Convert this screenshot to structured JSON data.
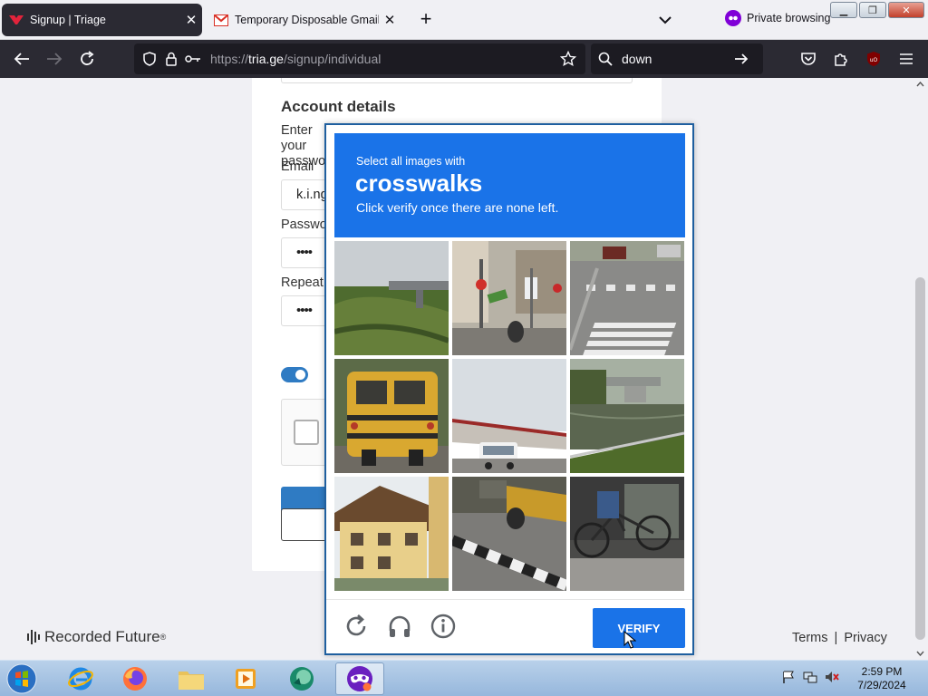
{
  "browser": {
    "tabs": [
      {
        "title": "Signup | Triage",
        "active": true
      },
      {
        "title": "Temporary Disposable Gmail | T",
        "active": false
      }
    ],
    "private_label": "Private browsing",
    "url_prefix": "https://",
    "url_host": "tria.ge",
    "url_path": "/signup/individual",
    "search_value": "down"
  },
  "page": {
    "section_title": "Account details",
    "description": "Enter your password and email address",
    "email_label": "Email",
    "email_value": "k.i.ng",
    "password_label": "Passwo",
    "password_value": "••••",
    "repeat_label": "Repeat",
    "repeat_value": "••••",
    "brand": "Recorded Future",
    "trademark": "®",
    "terms": "Terms",
    "separator": "|",
    "privacy": "Privacy"
  },
  "captcha": {
    "instruction": "Select all images with",
    "target": "crosswalks",
    "hint": "Click verify once there are none left.",
    "verify_label": "VERIFY",
    "tiles": [
      "grass-bridge",
      "street-signs",
      "crosswalk-intersection",
      "school-bus",
      "bus-depot",
      "river-bridge",
      "house",
      "curb-street",
      "bicycle"
    ]
  },
  "taskbar": {
    "time": "2:59 PM",
    "date": "7/29/2024"
  },
  "colors": {
    "accent": "#1a73e8",
    "browser_dark": "#2b2a33",
    "site_blue": "#2f7bc3"
  }
}
